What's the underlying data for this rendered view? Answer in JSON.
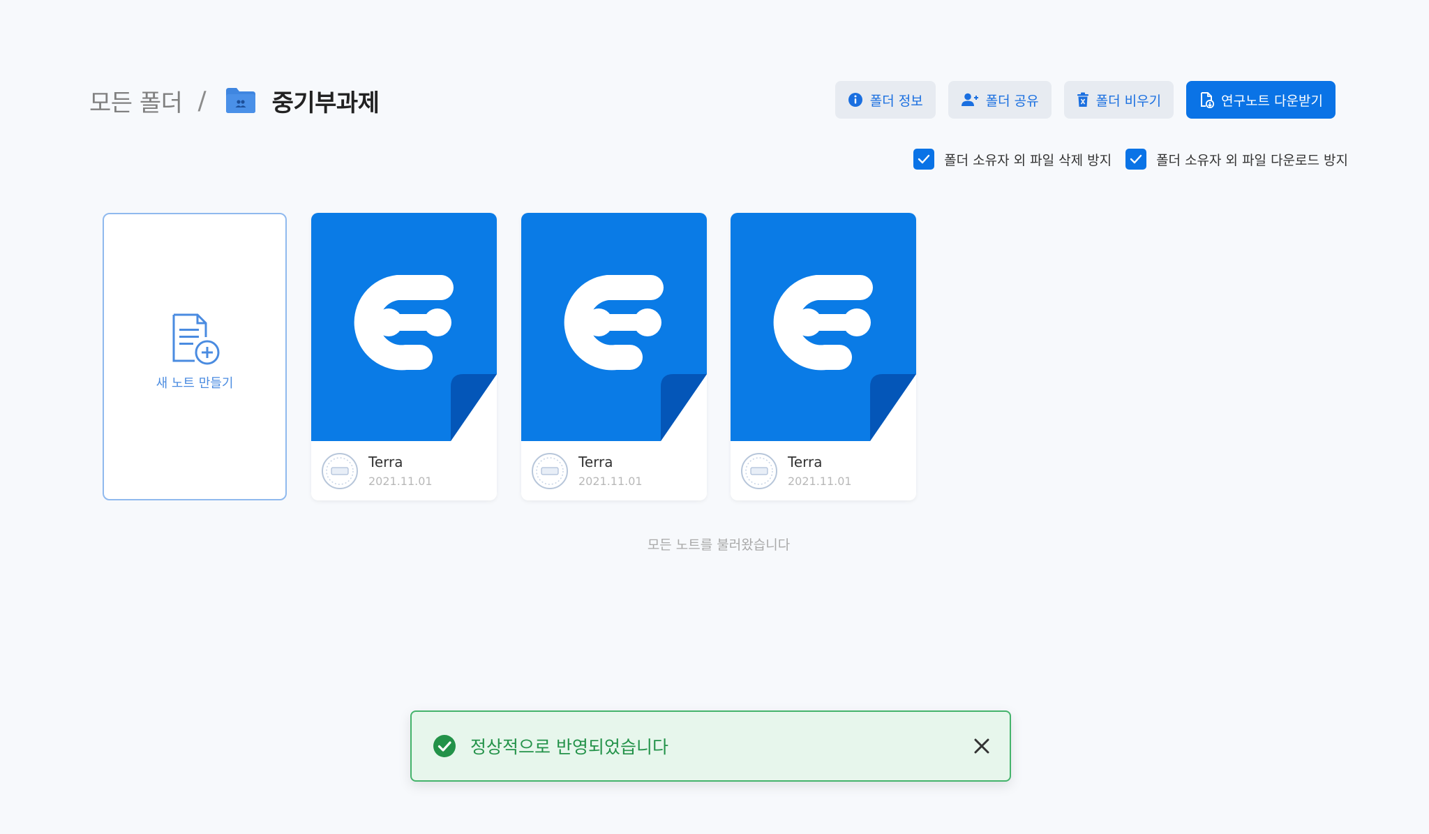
{
  "breadcrumb": {
    "root": "모든 폴더",
    "separator": "/",
    "current": "중기부과제"
  },
  "toolbar": {
    "info_label": "폴더 정보",
    "share_label": "폴더 공유",
    "empty_label": "폴더 비우기",
    "download_label": "연구노트 다운받기"
  },
  "options": {
    "prevent_delete_label": "폴더 소유자 외 파일 삭제 방지",
    "prevent_delete_checked": true,
    "prevent_download_label": "폴더 소유자 외 파일 다운로드 방지",
    "prevent_download_checked": true
  },
  "new_note": {
    "label": "새 노트 만들기"
  },
  "notes": [
    {
      "owner": "Terra",
      "date": "2021.11.01"
    },
    {
      "owner": "Terra",
      "date": "2021.11.01"
    },
    {
      "owner": "Terra",
      "date": "2021.11.01"
    }
  ],
  "status_message": "모든 노트를 불러왔습니다",
  "toast": {
    "message": "정상적으로 반영되었습니다"
  },
  "colors": {
    "accent": "#0a73e6",
    "thumb": "#0a7be6",
    "success": "#239249"
  }
}
